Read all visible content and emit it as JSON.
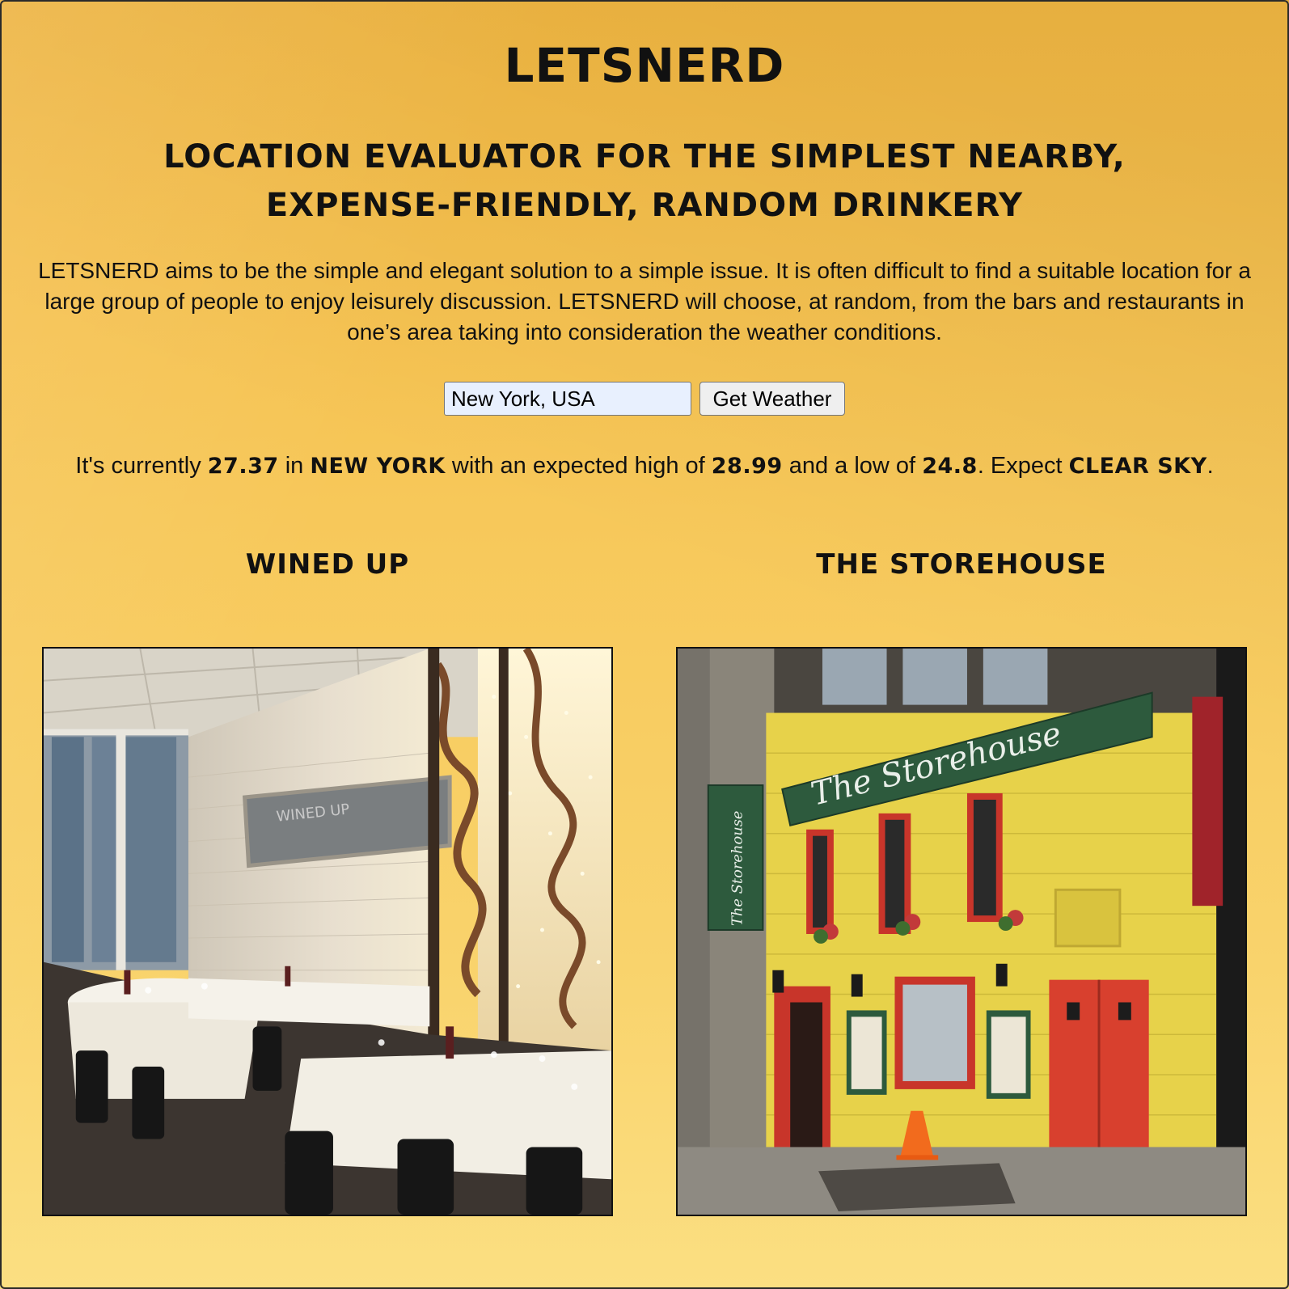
{
  "app": {
    "title": "LETSNERD",
    "subtitle": "Location evaluator for the simplest nearby, expense-friendly, random drinkery",
    "intro": "LETSNERD aims to be the simple and elegant solution to a simple issue. It is often difficult to find a suitable location for a large group of people to enjoy leisurely discussion. LETSNERD will choose, at random, from the bars and restaurants in one’s area taking into consideration the weather conditions."
  },
  "search": {
    "value": "New York, USA",
    "button_label": "Get Weather"
  },
  "weather": {
    "prefix": "It's currently",
    "current": "27.37",
    "in_text": "in",
    "city": "New York",
    "high_text": "with an expected high of",
    "high": "28.99",
    "low_text": "and a low of",
    "low": "24.8",
    "expect_text": ". Expect",
    "condition": "clear sky",
    "end": "."
  },
  "venues": [
    {
      "name": "Wined Up",
      "image_alt": "Restaurant interior with white tablecloths"
    },
    {
      "name": "The Storehouse",
      "image_alt": "Yellow brick storefront"
    }
  ],
  "photo_text": {
    "sign": "The Storehouse",
    "window_letters": "WINED UP"
  },
  "colors": {
    "bg_top": "#f3b842",
    "bg_bottom": "#fbdf82",
    "text": "#111111",
    "storefront_yellow": "#e7d24a",
    "door_red": "#d8402e",
    "sign_green": "#2d5a3d"
  }
}
